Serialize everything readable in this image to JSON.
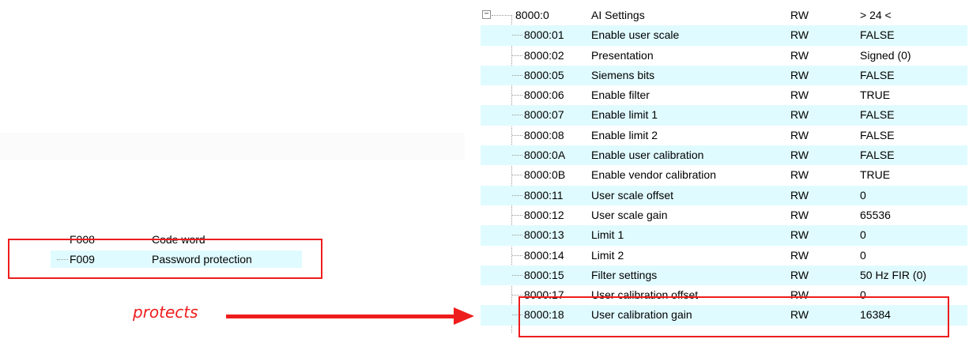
{
  "left_tree": {
    "rows": [
      {
        "index": "F008",
        "name": "Code word"
      },
      {
        "index": "F009",
        "name": "Password protection"
      }
    ]
  },
  "annotation": {
    "label": "protects",
    "color": "#ee1d1d"
  },
  "settings_tree": {
    "root": {
      "index": "8000:0",
      "name": "AI Settings",
      "flags": "RW",
      "value": "> 24 <",
      "expanded": true
    },
    "rows": [
      {
        "index": "8000:01",
        "name": "Enable user scale",
        "flags": "RW",
        "value": "FALSE"
      },
      {
        "index": "8000:02",
        "name": "Presentation",
        "flags": "RW",
        "value": "Signed (0)"
      },
      {
        "index": "8000:05",
        "name": "Siemens bits",
        "flags": "RW",
        "value": "FALSE"
      },
      {
        "index": "8000:06",
        "name": "Enable filter",
        "flags": "RW",
        "value": "TRUE"
      },
      {
        "index": "8000:07",
        "name": "Enable limit 1",
        "flags": "RW",
        "value": "FALSE"
      },
      {
        "index": "8000:08",
        "name": "Enable limit 2",
        "flags": "RW",
        "value": "FALSE"
      },
      {
        "index": "8000:0A",
        "name": "Enable user calibration",
        "flags": "RW",
        "value": "FALSE"
      },
      {
        "index": "8000:0B",
        "name": "Enable vendor calibration",
        "flags": "RW",
        "value": "TRUE"
      },
      {
        "index": "8000:11",
        "name": "User scale offset",
        "flags": "RW",
        "value": "0"
      },
      {
        "index": "8000:12",
        "name": "User scale gain",
        "flags": "RW",
        "value": "65536"
      },
      {
        "index": "8000:13",
        "name": "Limit 1",
        "flags": "RW",
        "value": "0"
      },
      {
        "index": "8000:14",
        "name": "Limit 2",
        "flags": "RW",
        "value": "0"
      },
      {
        "index": "8000:15",
        "name": "Filter settings",
        "flags": "RW",
        "value": "50 Hz FIR (0)"
      },
      {
        "index": "8000:17",
        "name": "User calibration offset",
        "flags": "RW",
        "value": "0"
      },
      {
        "index": "8000:18",
        "name": "User calibration gain",
        "flags": "RW",
        "value": "16384"
      }
    ]
  },
  "colors": {
    "highlight": "#ee1d1d",
    "row_alt": "#e0fbff"
  }
}
